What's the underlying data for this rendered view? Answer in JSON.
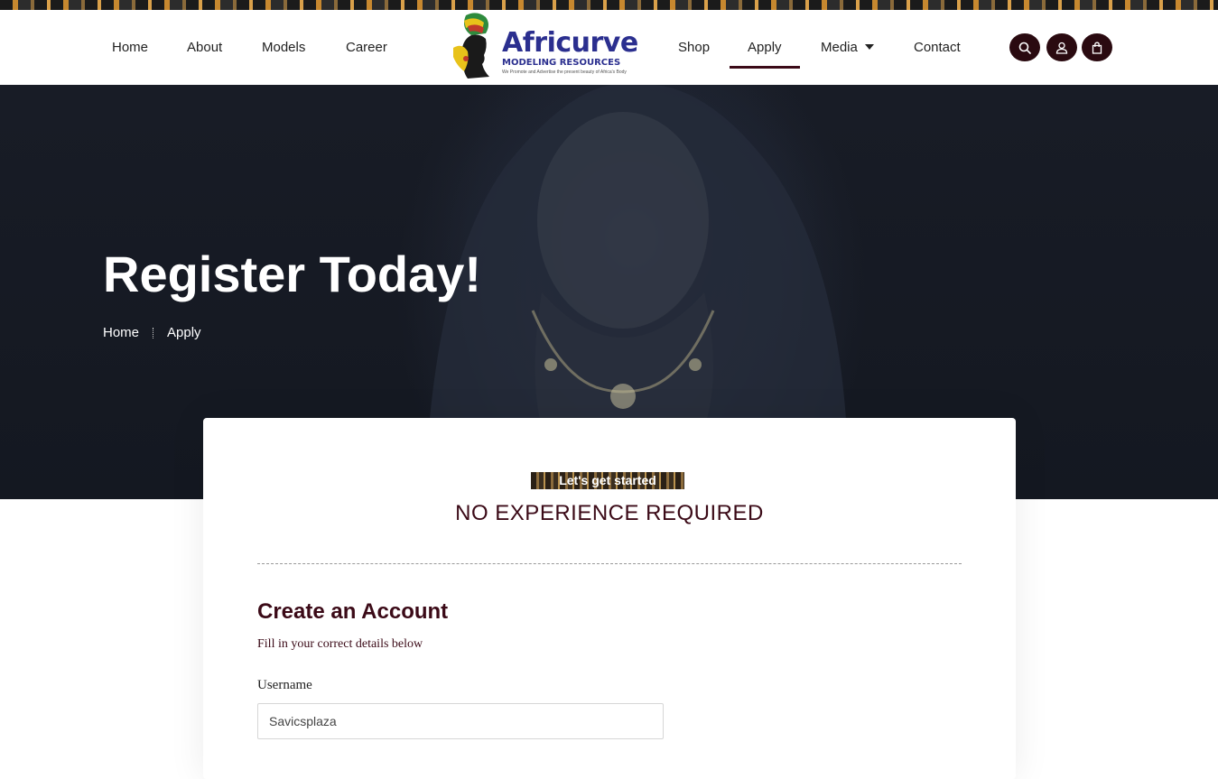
{
  "nav_left": [
    {
      "label": "Home"
    },
    {
      "label": "About"
    },
    {
      "label": "Models"
    },
    {
      "label": "Career"
    }
  ],
  "nav_right": [
    {
      "label": "Shop"
    },
    {
      "label": "Apply",
      "active": true
    },
    {
      "label": "Media",
      "has_dropdown": true
    },
    {
      "label": "Contact"
    }
  ],
  "logo": {
    "title": "Africurve",
    "subtitle": "MODELING RESOURCES",
    "tagline": "We Promote and Advertise the present beauty of Africa's Body"
  },
  "header_icons": [
    "search-icon",
    "user-icon",
    "shopping-bag-icon"
  ],
  "hero": {
    "title": "Register Today!",
    "breadcrumb": [
      "Home",
      "Apply"
    ]
  },
  "card": {
    "badge": "Let's get started",
    "heading": "NO EXPERIENCE REQUIRED",
    "form_title": "Create an Account",
    "form_subtitle": "Fill in your correct details below",
    "username_label": "Username",
    "username_value": "Savicsplaza"
  },
  "colors": {
    "accent": "#3b0a17",
    "icon_button_bg": "#2a0a10",
    "logo_blue": "#2b2f8f",
    "hero_bg": "#161a24"
  }
}
